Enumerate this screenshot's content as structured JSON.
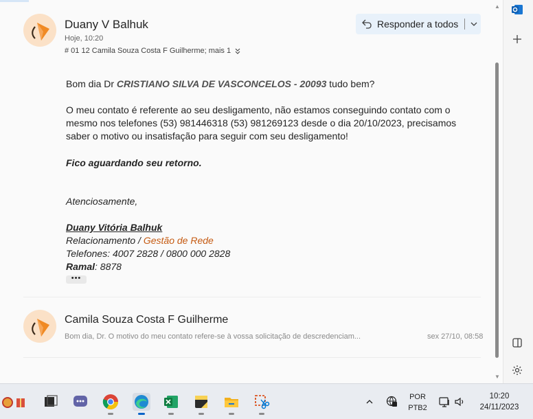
{
  "message1": {
    "sender": "Duany V Balhuk",
    "date": "Hoje, 10:20",
    "recipients": "# 01 12 Camila Souza Costa F Guilherme; mais 1",
    "reply_all_label": "Responder a todos",
    "greeting_prefix": "Bom dia Dr ",
    "greeting_name": "CRISTIANO SILVA DE VASCONCELOS - 20093",
    "greeting_suffix": " tudo bem?",
    "paragraph_lines": [
      "O meu contato é referente ao seu desligamento, não estamos conseguindo contato com o",
      "mesmo nos telefones (53) 981446318 (53) 981269123 desde o dia 20/10/2023, precisamos",
      "saber o motivo ou insatisfação para seguir com seu desligamento!"
    ],
    "waiting_line": "Fico aguardando seu retorno.",
    "closing": "Atenciosamente,",
    "signature": {
      "name": "Duany Vitória Balhuk ",
      "role_prefix": "Relacionamento / ",
      "role_link": "Gestão de Rede",
      "phones": "Telefones: 4007 2828 / 0800 000 2828",
      "ramal_label": "Ramal",
      "ramal_value": ": 8878"
    },
    "more_label": "•••"
  },
  "message2": {
    "sender": "Camila Souza Costa F Guilherme",
    "preview": "Bom dia, Dr. O motivo do meu contato refere-se à vossa solicitação de descredenciam...",
    "date": "sex 27/10, 08:58"
  },
  "taskbar": {
    "lang_top": "POR",
    "lang_bottom": "PTB2",
    "time": "10:20",
    "date": "24/11/2023"
  },
  "colors": {
    "avatar_bg": "#fbe1c7",
    "avatar_orange": "#f08a24",
    "link": "#c55a11",
    "reply_bg": "#e8f1fa"
  }
}
